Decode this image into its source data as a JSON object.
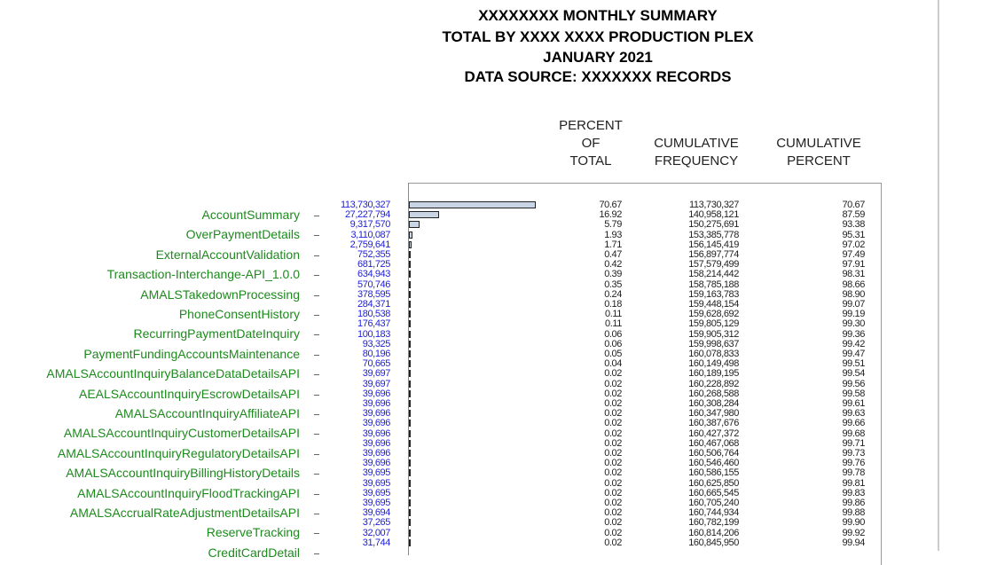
{
  "titles": [
    "XXXXXXXX MONTHLY SUMMARY",
    "TOTAL BY XXXX XXXX PRODUCTION PLEX",
    "JANUARY 2021",
    "DATA SOURCE: XXXXXXX RECORDS"
  ],
  "headers": {
    "percent_of_total": [
      "PERCENT",
      "OF",
      "TOTAL"
    ],
    "cumulative_frequency": [
      "CUMULATIVE",
      "FREQUENCY"
    ],
    "cumulative_percent": [
      "CUMULATIVE",
      "PERCENT"
    ]
  },
  "colors": {
    "bar_fill": "#c9d5e5",
    "label": "#1d8a1d",
    "count": "#2020e0"
  },
  "chart_data": {
    "type": "bar",
    "orientation": "horizontal",
    "title": "XXXXXXXX MONTHLY SUMMARY",
    "labels": [
      "AccountSummary",
      "OverPaymentDetails",
      "ExternalAccountValidation",
      "Transaction-Interchange-API_1.0.0",
      "AMALSTakedownProcessing",
      "PhoneConsentHistory",
      "RecurringPaymentDateInquiry",
      "PaymentFundingAccountsMaintenance",
      "AMALSAccountInquiryBalanceDataDetailsAPI",
      "AEALSAccountInquiryEscrowDetailsAPI",
      "AMALSAccountInquiryAffiliateAPI",
      "AMALSAccountInquiryCustomerDetailsAPI",
      "AMALSAccountInquiryRegulatoryDetailsAPI",
      "AMALSAccountInquiryBillingHistoryDetails",
      "AMALSAccountInquiryFloodTrackingAPI",
      "AMALSAccrualRateAdjustmentDetailsAPI",
      "ReserveTracking",
      "CreditCardDetail"
    ],
    "counts": [
      "113,730,327",
      "27,227,794",
      "9,317,570",
      "3,110,087",
      "2,759,641",
      "752,355",
      "681,725",
      "634,943",
      "570,746",
      "378,595",
      "284,371",
      "180,538",
      "176,437",
      "100,183",
      "93,325",
      "80,196",
      "70,665",
      "39,697",
      "39,697",
      "39,696",
      "39,696",
      "39,696",
      "39,696",
      "39,696",
      "39,696",
      "39,696",
      "39,696",
      "39,695",
      "39,695",
      "39,695",
      "39,695",
      "39,694",
      "37,265",
      "32,007",
      "31,744"
    ],
    "values": [
      113730327,
      27227794,
      9317570,
      3110087,
      2759641,
      752355,
      681725,
      634943,
      570746,
      378595,
      284371,
      180538,
      176437,
      100183,
      93325,
      80196,
      70665,
      39697,
      39697,
      39696,
      39696,
      39696,
      39696,
      39696,
      39696,
      39696,
      39696,
      39695,
      39695,
      39695,
      39695,
      39694,
      37265,
      32007,
      31744
    ],
    "percent_of_total": [
      "70.67",
      "16.92",
      "5.79",
      "1.93",
      "1.71",
      "0.47",
      "0.42",
      "0.39",
      "0.35",
      "0.24",
      "0.18",
      "0.11",
      "0.11",
      "0.06",
      "0.06",
      "0.05",
      "0.04",
      "0.02",
      "0.02",
      "0.02",
      "0.02",
      "0.02",
      "0.02",
      "0.02",
      "0.02",
      "0.02",
      "0.02",
      "0.02",
      "0.02",
      "0.02",
      "0.02",
      "0.02",
      "0.02",
      "0.02",
      "0.02"
    ],
    "cumulative_frequency": [
      "113,730,327",
      "140,958,121",
      "150,275,691",
      "153,385,778",
      "156,145,419",
      "156,897,774",
      "157,579,499",
      "158,214,442",
      "158,785,188",
      "159,163,783",
      "159,448,154",
      "159,628,692",
      "159,805,129",
      "159,905,312",
      "159,998,637",
      "160,078,833",
      "160,149,498",
      "160,189,195",
      "160,228,892",
      "160,268,588",
      "160,308,284",
      "160,347,980",
      "160,387,676",
      "160,427,372",
      "160,467,068",
      "160,506,764",
      "160,546,460",
      "160,586,155",
      "160,625,850",
      "160,665,545",
      "160,705,240",
      "160,744,934",
      "160,782,199",
      "160,814,206",
      "160,845,950"
    ],
    "cumulative_percent": [
      "70.67",
      "87.59",
      "93.38",
      "95.31",
      "97.02",
      "97.49",
      "97.91",
      "98.31",
      "98.66",
      "98.90",
      "99.07",
      "99.19",
      "99.30",
      "99.36",
      "99.42",
      "99.47",
      "99.51",
      "99.54",
      "99.56",
      "99.58",
      "99.61",
      "99.63",
      "99.66",
      "99.68",
      "99.71",
      "99.73",
      "99.76",
      "99.78",
      "99.81",
      "99.83",
      "99.86",
      "99.88",
      "99.90",
      "99.92",
      "99.94"
    ]
  }
}
